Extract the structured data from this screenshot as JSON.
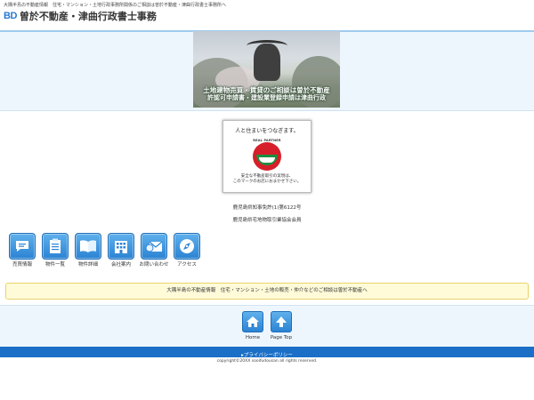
{
  "header": {
    "tagline": "大隅半島の不動産情報　住宅・マンション・土地行政事務所関係のご相談は曽於不動産・津曲行政書士事務所へ",
    "logo_mark": "BD",
    "logo_text": "曽於不動産・津曲行政書士事務"
  },
  "hero": {
    "caption_line1": "土地建物売買・賃貸のご相談は曽於不動産",
    "caption_line2": "許認可申請書・建設業登録申請は津曲行政"
  },
  "badge": {
    "top_text": "人と住まいをつなぎます。",
    "emblem_text": "REAL PARTNER",
    "bottom_line1": "安全な不動産取引の実現は、",
    "bottom_line2": "このマークのお店におまかせ下さい。"
  },
  "registration": {
    "license": "鹿児島県知事免許(1)第6122号",
    "association": "鹿児島県宅地物取引業協会会員"
  },
  "nav": [
    {
      "label": "売買情報",
      "icon": "chat-icon"
    },
    {
      "label": "物件一覧",
      "icon": "clipboard-icon"
    },
    {
      "label": "物件詳細",
      "icon": "book-icon"
    },
    {
      "label": "会社案内",
      "icon": "building-icon"
    },
    {
      "label": "お問い合わせ",
      "icon": "mail-icon"
    },
    {
      "label": "アクセス",
      "icon": "compass-icon"
    }
  ],
  "notice": "大隅半島の不動産情報　住宅・マンション・土地の販売・仲介などのご相談は曽於不動産へ",
  "footer": {
    "home_label": "Home",
    "pagetop_label": "Page Top",
    "privacy_link": "▸プライバシーポリシー",
    "copyright": "copyright©20XX sooifudousan all rights reserved."
  },
  "colors": {
    "accent": "#2b83d3",
    "bar": "#1b6fc6",
    "notice_bg": "#fffbd9"
  }
}
